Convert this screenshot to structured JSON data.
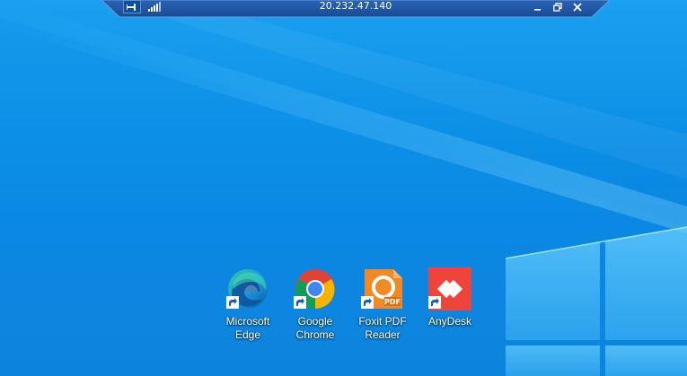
{
  "remote_bar": {
    "title": "20.232.47.140",
    "pin_icon": "pin-icon",
    "signal_icon": "connection-quality-icon",
    "minimize_icon": "minimize-icon",
    "restore_icon": "restore-icon",
    "close_icon": "close-icon"
  },
  "desktop": {
    "wallpaper": "windows-10-hero-light-blue",
    "icons": [
      {
        "label": "Microsoft\nEdge",
        "icon": "edge-icon",
        "accent": "#0c59a4"
      },
      {
        "label": "Google\nChrome",
        "icon": "chrome-icon",
        "accent": "#db4437"
      },
      {
        "label": "Foxit PDF\nReader",
        "icon": "foxit-pdf-icon",
        "accent": "#f08a24"
      },
      {
        "label": "AnyDesk",
        "icon": "anydesk-icon",
        "accent": "#ef443b"
      }
    ]
  },
  "colors": {
    "background": "#0a84e0",
    "bar": "#1f56a8"
  }
}
